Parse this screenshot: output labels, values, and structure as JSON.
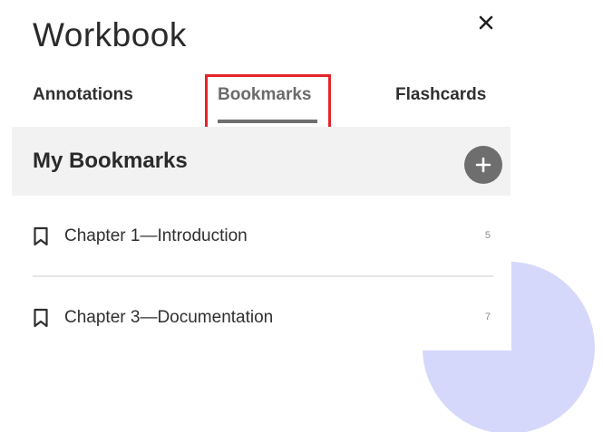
{
  "panel": {
    "title": "Workbook",
    "close_icon": "close-icon"
  },
  "tabs": [
    {
      "label": "Annotations",
      "active": false
    },
    {
      "label": "Bookmarks",
      "active": true
    },
    {
      "label": "Flashcards",
      "active": false
    }
  ],
  "section": {
    "title": "My Bookmarks",
    "add_icon": "plus-icon"
  },
  "bookmarks": [
    {
      "label": "Chapter 1—Introduction",
      "count": "5",
      "icon": "bookmark-icon"
    },
    {
      "label": "Chapter 3—Documentation",
      "count": "7",
      "icon": "bookmark-icon"
    }
  ],
  "colors": {
    "highlight": "#e3242b",
    "header_bg": "#f2f2f2",
    "add_button": "#6e6e6e",
    "decor": "#d6d8fb"
  }
}
